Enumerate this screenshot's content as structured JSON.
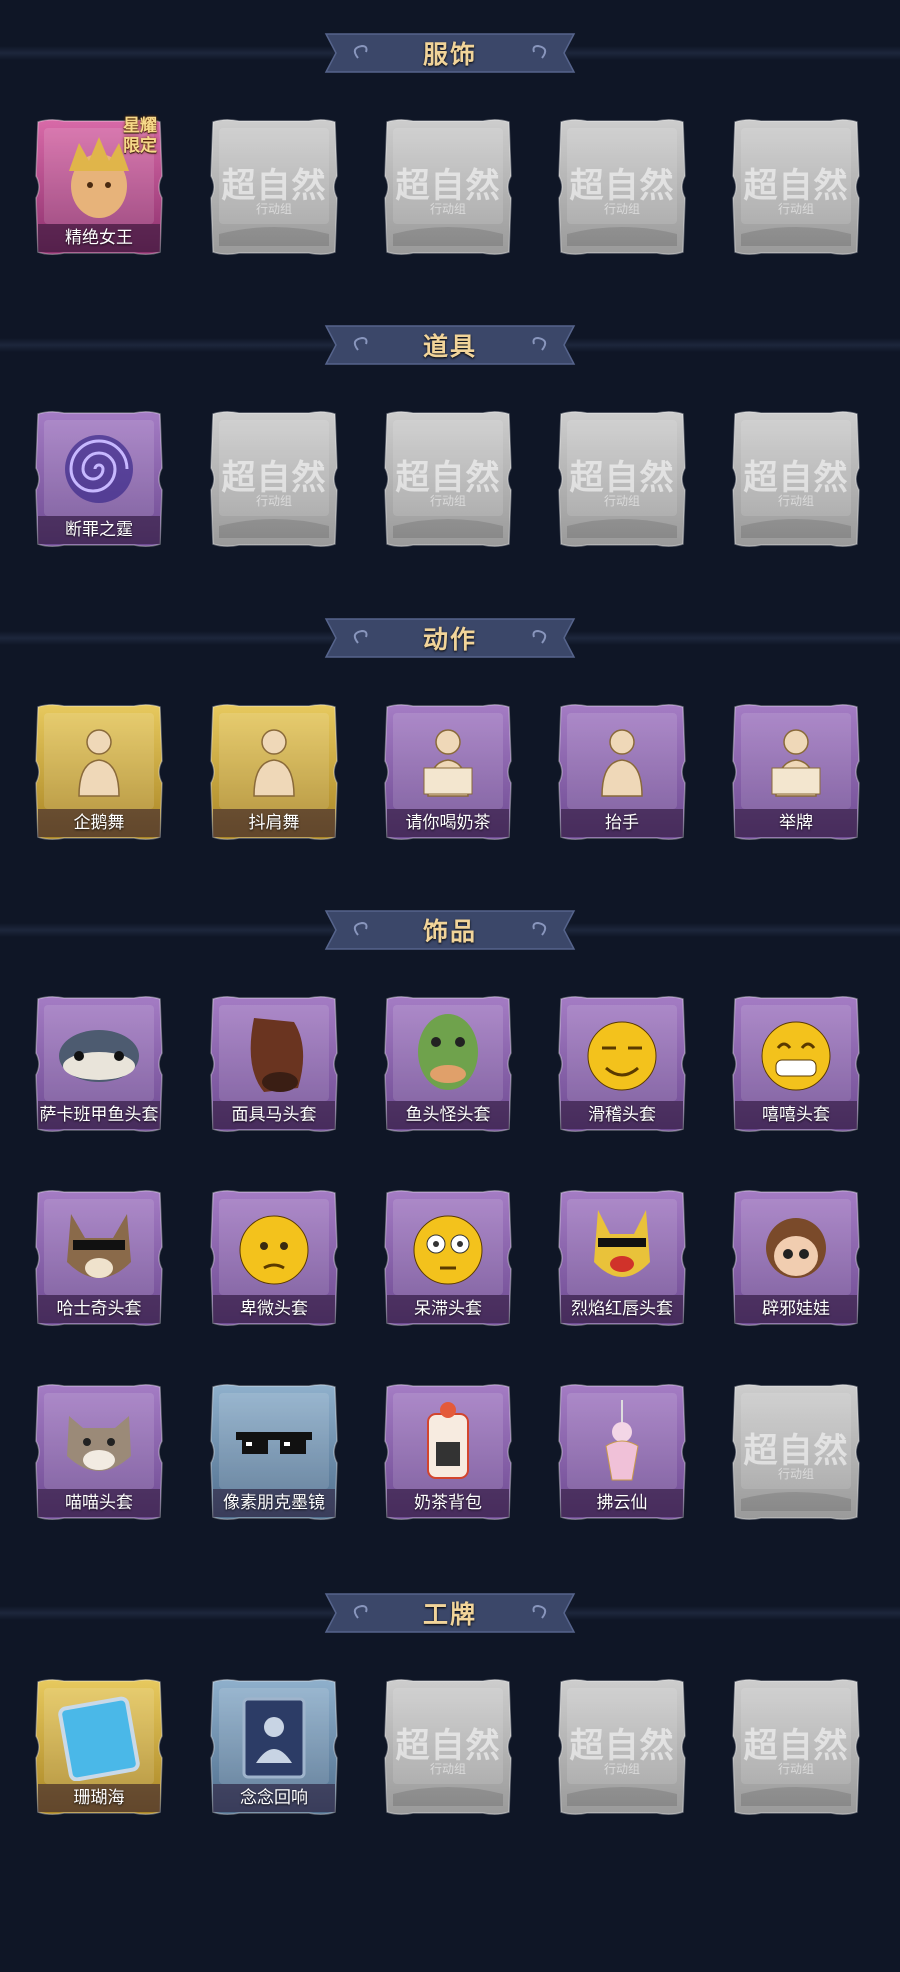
{
  "colors": {
    "background": "#0f1626",
    "banner": "#3a4668",
    "banner_text": "#f1d49a",
    "card_purple": "#8e67b0",
    "card_gold": "#d4b24a",
    "card_pink": "#c14f96",
    "card_blue": "#6f8fae",
    "card_empty": "#b8b8b8"
  },
  "placeholder": {
    "title": "超自然",
    "subtitle": "行动组"
  },
  "sections": [
    {
      "title": "服饰",
      "items": [
        {
          "label": "精绝女王",
          "tier": "pink",
          "icon": "queen-portrait-icon",
          "badge": "星耀\n限定"
        },
        {
          "label": "",
          "tier": "empty",
          "icon": ""
        },
        {
          "label": "",
          "tier": "empty",
          "icon": ""
        },
        {
          "label": "",
          "tier": "empty",
          "icon": ""
        },
        {
          "label": "",
          "tier": "empty",
          "icon": ""
        }
      ]
    },
    {
      "title": "道具",
      "items": [
        {
          "label": "断罪之霆",
          "tier": "purple",
          "icon": "spiral-lightning-icon"
        },
        {
          "label": "",
          "tier": "empty",
          "icon": ""
        },
        {
          "label": "",
          "tier": "empty",
          "icon": ""
        },
        {
          "label": "",
          "tier": "empty",
          "icon": ""
        },
        {
          "label": "",
          "tier": "empty",
          "icon": ""
        }
      ]
    },
    {
      "title": "动作",
      "items": [
        {
          "label": "企鹅舞",
          "tier": "gold",
          "icon": "penguin-dance-icon"
        },
        {
          "label": "抖肩舞",
          "tier": "gold",
          "icon": "shoulder-dance-icon"
        },
        {
          "label": "请你喝奶茶",
          "tier": "purple",
          "icon": "milk-tea-offer-icon"
        },
        {
          "label": "抬手",
          "tier": "purple",
          "icon": "raise-hand-icon"
        },
        {
          "label": "举牌",
          "tier": "purple",
          "icon": "hold-sign-icon"
        }
      ]
    },
    {
      "title": "饰品",
      "items": [
        {
          "label": "萨卡班甲鱼头套",
          "tier": "purple",
          "icon": "sacabambaspis-head-icon"
        },
        {
          "label": "面具马头套",
          "tier": "purple",
          "icon": "horse-mask-icon"
        },
        {
          "label": "鱼头怪头套",
          "tier": "purple",
          "icon": "fish-monster-head-icon"
        },
        {
          "label": "滑稽头套",
          "tier": "purple",
          "icon": "funny-face-head-icon"
        },
        {
          "label": "嘻嘻头套",
          "tier": "purple",
          "icon": "grin-face-head-icon"
        },
        {
          "label": "哈士奇头套",
          "tier": "purple",
          "icon": "husky-head-icon"
        },
        {
          "label": "卑微头套",
          "tier": "purple",
          "icon": "humble-face-head-icon"
        },
        {
          "label": "呆滞头套",
          "tier": "purple",
          "icon": "dazed-face-head-icon"
        },
        {
          "label": "烈焰红唇头套",
          "tier": "purple",
          "icon": "red-lips-head-icon"
        },
        {
          "label": "辟邪娃娃",
          "tier": "purple",
          "icon": "doll-head-icon"
        },
        {
          "label": "喵喵头套",
          "tier": "purple",
          "icon": "cat-head-icon"
        },
        {
          "label": "像素朋克墨镜",
          "tier": "blue",
          "icon": "pixel-sunglasses-icon"
        },
        {
          "label": "奶茶背包",
          "tier": "purple",
          "icon": "milk-tea-backpack-icon"
        },
        {
          "label": "拂云仙",
          "tier": "purple",
          "icon": "cloud-fairy-pendant-icon"
        },
        {
          "label": "",
          "tier": "empty",
          "icon": ""
        }
      ]
    },
    {
      "title": "工牌",
      "items": [
        {
          "label": "珊瑚海",
          "tier": "gold",
          "icon": "coral-sea-badge-icon"
        },
        {
          "label": "念念回响",
          "tier": "blue",
          "icon": "echo-badge-icon"
        },
        {
          "label": "",
          "tier": "empty",
          "icon": ""
        },
        {
          "label": "",
          "tier": "empty",
          "icon": ""
        },
        {
          "label": "",
          "tier": "empty",
          "icon": ""
        }
      ]
    }
  ]
}
